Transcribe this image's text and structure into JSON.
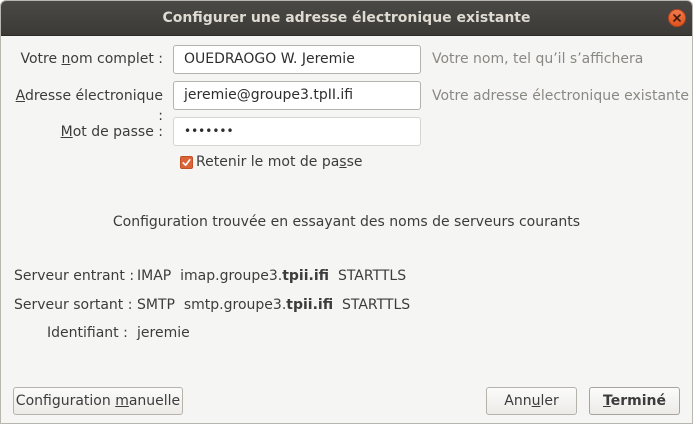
{
  "window": {
    "title": "Configurer une adresse électronique existante"
  },
  "form": {
    "name": {
      "label_before": "Votre ",
      "label_mnemonic": "n",
      "label_after": "om complet :",
      "value": "OUEDRAOGO W. Jeremie",
      "hint": "Votre nom, tel qu’il s’affichera"
    },
    "email": {
      "label_before": "",
      "label_mnemonic": "A",
      "label_after": "dresse électronique :",
      "value": "jeremie@groupe3.tpII.ifi",
      "hint": "Votre adresse électronique existante"
    },
    "password": {
      "label_before": "",
      "label_mnemonic": "M",
      "label_after": "ot de passe :",
      "value": "•••••••"
    },
    "remember": {
      "checked": true,
      "label_before": "Retenir le mot de pa",
      "label_mnemonic": "s",
      "label_after": "se"
    }
  },
  "status_message": "Configuration trouvée en essayant des noms de serveurs courants",
  "servers": {
    "incoming": {
      "label": "Serveur entrant :",
      "protocol": "IMAP",
      "host_prefix": "imap.groupe3.",
      "host_bold": "tpii.ifi",
      "security": "STARTTLS"
    },
    "outgoing": {
      "label": "Serveur sortant :",
      "protocol": "SMTP",
      "host_prefix": "smtp.groupe3.",
      "host_bold": "tpii.ifi",
      "security": "STARTTLS"
    },
    "identity": {
      "label": "Identifiant :",
      "value": "jeremie"
    }
  },
  "buttons": {
    "manual": {
      "before": "Configuration ",
      "mnemonic": "m",
      "after": "anuelle"
    },
    "cancel": {
      "before": "Ann",
      "mnemonic": "u",
      "after": "ler"
    },
    "done": {
      "before": "",
      "mnemonic": "T",
      "after": "erminé"
    }
  },
  "colors": {
    "titlebar": "#3b3a36",
    "close_button": "#e0531f",
    "checkbox_accent": "#dc6537",
    "hint_text": "#8a8882"
  },
  "icons": {
    "close": "close-icon",
    "check": "check-icon"
  }
}
